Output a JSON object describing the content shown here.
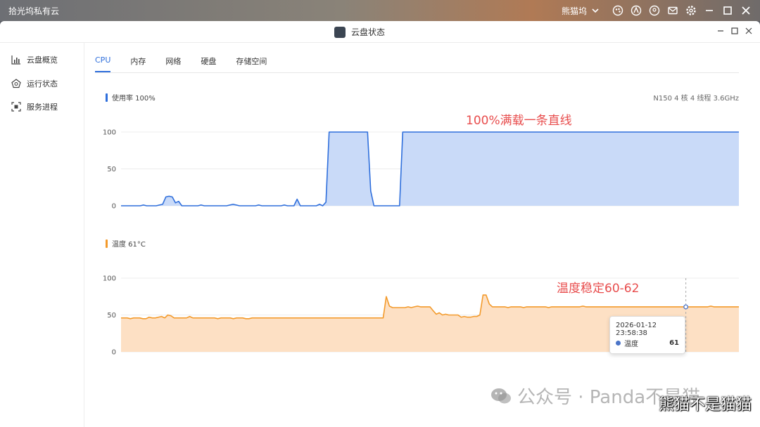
{
  "app": {
    "title": "拾光坞私有云",
    "user": "熊猫坞"
  },
  "window": {
    "title": "云盘状态"
  },
  "sidebar": {
    "items": [
      {
        "label": "云盘概览",
        "icon": "bar-chart-icon"
      },
      {
        "label": "运行状态",
        "icon": "pentagon-icon"
      },
      {
        "label": "服务进程",
        "icon": "process-icon"
      }
    ]
  },
  "tabs": [
    {
      "label": "CPU",
      "active": true
    },
    {
      "label": "内存",
      "active": false
    },
    {
      "label": "网络",
      "active": false
    },
    {
      "label": "硬盘",
      "active": false
    },
    {
      "label": "存储空间",
      "active": false
    }
  ],
  "cpu": {
    "label": "使用率 100%",
    "info": "N150 4 核 4 线程 3.6GHz",
    "color": "#2f6fdc",
    "fill": "#c9daf8"
  },
  "temp": {
    "label": "温度 61°C",
    "color": "#f39a2b",
    "fill": "#fde0c4"
  },
  "annotations": {
    "cpu": "100%满载一条直线",
    "temp": "温度稳定60-62"
  },
  "tooltip": {
    "time": "2026-01-12 23:58:38",
    "series": "温度",
    "value": "61"
  },
  "watermark": {
    "text": "公众号 · Panda不是猫",
    "corner": "熊猫不是猫猫"
  },
  "chart_data": [
    {
      "type": "area",
      "ylim": [
        0,
        100
      ],
      "yticks": [
        "0",
        "50",
        "100"
      ],
      "series": [
        {
          "values": [
            0,
            0,
            0,
            0,
            0,
            0,
            0,
            1,
            0,
            0,
            0,
            0,
            1,
            2,
            12,
            13,
            12,
            4,
            6,
            0,
            0,
            0,
            0,
            0,
            0,
            1,
            0,
            0,
            0,
            0,
            0,
            0,
            0,
            0,
            1,
            2,
            1,
            0,
            0,
            0,
            0,
            0,
            0,
            1,
            0,
            0,
            0,
            0,
            0,
            0,
            0,
            1,
            0,
            0,
            0,
            9,
            0,
            0,
            0,
            0,
            0,
            0,
            2,
            0,
            5,
            100,
            100,
            100,
            100,
            100,
            100,
            100,
            100,
            100,
            100,
            100,
            100,
            100,
            20,
            0,
            0,
            0,
            0,
            0,
            0,
            0,
            0,
            0,
            100,
            100,
            100,
            100,
            100,
            100,
            100,
            100,
            100,
            100,
            100,
            100,
            100,
            100,
            100,
            100,
            100,
            100,
            100,
            100,
            100,
            100,
            100,
            100,
            100,
            100,
            100,
            100,
            100,
            100,
            100,
            100,
            100,
            100,
            100,
            100,
            100,
            100,
            100,
            100,
            100,
            100,
            100,
            100,
            100,
            100,
            100,
            100,
            100,
            100,
            100,
            100,
            100,
            100,
            100,
            100,
            100,
            100,
            100,
            100,
            100,
            100,
            100,
            100,
            100,
            100,
            100,
            100,
            100,
            100,
            100,
            100,
            100,
            100,
            100,
            100,
            100,
            100,
            100,
            100,
            100,
            100,
            100,
            100,
            100,
            100,
            100,
            100,
            100,
            100,
            100,
            100,
            100,
            100,
            100,
            100,
            100,
            100,
            100,
            100,
            100,
            100,
            100,
            100,
            100,
            100
          ]
        }
      ]
    },
    {
      "type": "area",
      "ylim": [
        0,
        100
      ],
      "yticks": [
        "0",
        "50",
        "100"
      ],
      "series": [
        {
          "values": [
            46,
            46,
            46,
            45,
            46,
            46,
            46,
            45,
            45,
            47,
            46,
            46,
            47,
            48,
            46,
            50,
            49,
            46,
            46,
            46,
            46,
            46,
            48,
            46,
            46,
            46,
            46,
            46,
            46,
            46,
            46,
            45,
            46,
            46,
            46,
            46,
            45,
            46,
            46,
            46,
            45,
            45,
            46,
            46,
            46,
            46,
            46,
            46,
            46,
            46,
            46,
            46,
            46,
            46,
            46,
            46,
            46,
            46,
            46,
            46,
            46,
            46,
            46,
            46,
            46,
            46,
            46,
            46,
            46,
            46,
            46,
            46,
            46,
            46,
            46,
            46,
            46,
            46,
            46,
            46,
            46,
            46,
            46,
            46,
            46,
            75,
            62,
            60,
            60,
            60,
            60,
            60,
            61,
            60,
            61,
            62,
            61,
            61,
            61,
            61,
            56,
            51,
            53,
            50,
            51,
            50,
            50,
            50,
            50,
            47,
            48,
            47,
            47,
            48,
            48,
            50,
            77,
            77,
            65,
            61,
            61,
            61,
            61,
            61,
            60,
            61,
            61,
            61,
            61,
            60,
            61,
            61,
            61,
            61,
            61,
            61,
            61,
            60,
            61,
            61,
            61,
            61,
            61,
            61,
            61,
            61,
            61,
            61,
            62,
            61,
            61,
            61,
            61,
            61,
            61,
            61,
            61,
            61,
            61,
            61,
            61,
            61,
            61,
            61,
            61,
            61,
            61,
            61,
            61,
            61,
            61,
            61,
            61,
            61,
            61,
            61,
            61,
            61,
            61,
            61,
            61,
            61,
            61,
            61,
            61,
            61,
            61,
            61,
            61,
            62,
            61,
            61,
            61,
            61,
            61,
            61,
            61,
            61,
            61
          ]
        }
      ],
      "hover_index": 181
    }
  ]
}
